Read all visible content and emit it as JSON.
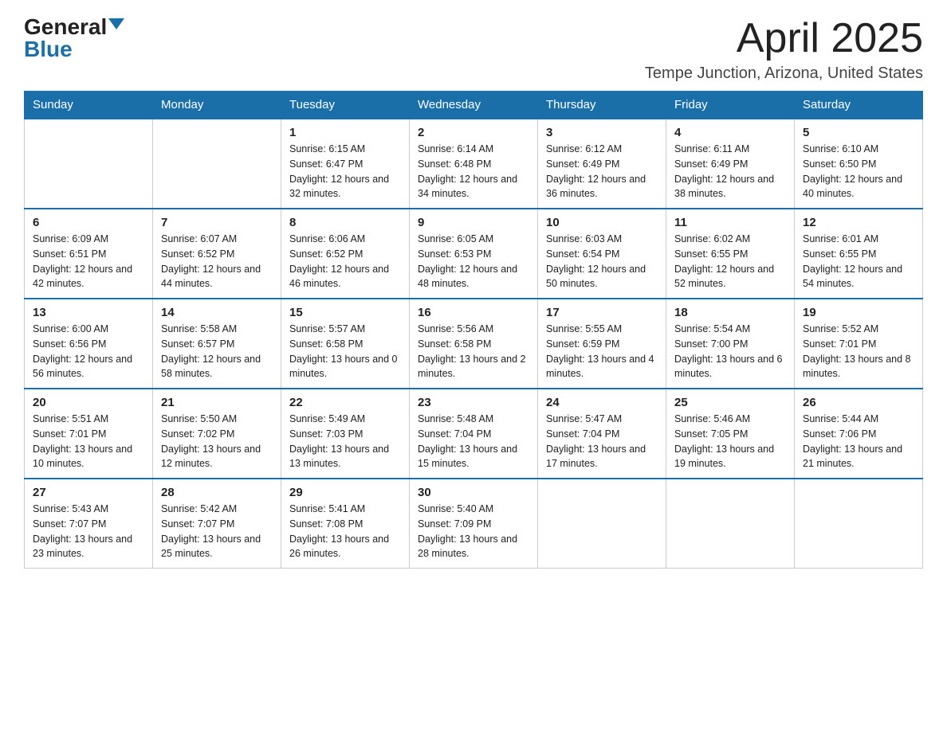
{
  "header": {
    "logo_general": "General",
    "logo_blue": "Blue",
    "month_title": "April 2025",
    "location": "Tempe Junction, Arizona, United States"
  },
  "weekdays": [
    "Sunday",
    "Monday",
    "Tuesday",
    "Wednesday",
    "Thursday",
    "Friday",
    "Saturday"
  ],
  "weeks": [
    [
      {
        "day": "",
        "sunrise": "",
        "sunset": "",
        "daylight": ""
      },
      {
        "day": "",
        "sunrise": "",
        "sunset": "",
        "daylight": ""
      },
      {
        "day": "1",
        "sunrise": "Sunrise: 6:15 AM",
        "sunset": "Sunset: 6:47 PM",
        "daylight": "Daylight: 12 hours and 32 minutes."
      },
      {
        "day": "2",
        "sunrise": "Sunrise: 6:14 AM",
        "sunset": "Sunset: 6:48 PM",
        "daylight": "Daylight: 12 hours and 34 minutes."
      },
      {
        "day": "3",
        "sunrise": "Sunrise: 6:12 AM",
        "sunset": "Sunset: 6:49 PM",
        "daylight": "Daylight: 12 hours and 36 minutes."
      },
      {
        "day": "4",
        "sunrise": "Sunrise: 6:11 AM",
        "sunset": "Sunset: 6:49 PM",
        "daylight": "Daylight: 12 hours and 38 minutes."
      },
      {
        "day": "5",
        "sunrise": "Sunrise: 6:10 AM",
        "sunset": "Sunset: 6:50 PM",
        "daylight": "Daylight: 12 hours and 40 minutes."
      }
    ],
    [
      {
        "day": "6",
        "sunrise": "Sunrise: 6:09 AM",
        "sunset": "Sunset: 6:51 PM",
        "daylight": "Daylight: 12 hours and 42 minutes."
      },
      {
        "day": "7",
        "sunrise": "Sunrise: 6:07 AM",
        "sunset": "Sunset: 6:52 PM",
        "daylight": "Daylight: 12 hours and 44 minutes."
      },
      {
        "day": "8",
        "sunrise": "Sunrise: 6:06 AM",
        "sunset": "Sunset: 6:52 PM",
        "daylight": "Daylight: 12 hours and 46 minutes."
      },
      {
        "day": "9",
        "sunrise": "Sunrise: 6:05 AM",
        "sunset": "Sunset: 6:53 PM",
        "daylight": "Daylight: 12 hours and 48 minutes."
      },
      {
        "day": "10",
        "sunrise": "Sunrise: 6:03 AM",
        "sunset": "Sunset: 6:54 PM",
        "daylight": "Daylight: 12 hours and 50 minutes."
      },
      {
        "day": "11",
        "sunrise": "Sunrise: 6:02 AM",
        "sunset": "Sunset: 6:55 PM",
        "daylight": "Daylight: 12 hours and 52 minutes."
      },
      {
        "day": "12",
        "sunrise": "Sunrise: 6:01 AM",
        "sunset": "Sunset: 6:55 PM",
        "daylight": "Daylight: 12 hours and 54 minutes."
      }
    ],
    [
      {
        "day": "13",
        "sunrise": "Sunrise: 6:00 AM",
        "sunset": "Sunset: 6:56 PM",
        "daylight": "Daylight: 12 hours and 56 minutes."
      },
      {
        "day": "14",
        "sunrise": "Sunrise: 5:58 AM",
        "sunset": "Sunset: 6:57 PM",
        "daylight": "Daylight: 12 hours and 58 minutes."
      },
      {
        "day": "15",
        "sunrise": "Sunrise: 5:57 AM",
        "sunset": "Sunset: 6:58 PM",
        "daylight": "Daylight: 13 hours and 0 minutes."
      },
      {
        "day": "16",
        "sunrise": "Sunrise: 5:56 AM",
        "sunset": "Sunset: 6:58 PM",
        "daylight": "Daylight: 13 hours and 2 minutes."
      },
      {
        "day": "17",
        "sunrise": "Sunrise: 5:55 AM",
        "sunset": "Sunset: 6:59 PM",
        "daylight": "Daylight: 13 hours and 4 minutes."
      },
      {
        "day": "18",
        "sunrise": "Sunrise: 5:54 AM",
        "sunset": "Sunset: 7:00 PM",
        "daylight": "Daylight: 13 hours and 6 minutes."
      },
      {
        "day": "19",
        "sunrise": "Sunrise: 5:52 AM",
        "sunset": "Sunset: 7:01 PM",
        "daylight": "Daylight: 13 hours and 8 minutes."
      }
    ],
    [
      {
        "day": "20",
        "sunrise": "Sunrise: 5:51 AM",
        "sunset": "Sunset: 7:01 PM",
        "daylight": "Daylight: 13 hours and 10 minutes."
      },
      {
        "day": "21",
        "sunrise": "Sunrise: 5:50 AM",
        "sunset": "Sunset: 7:02 PM",
        "daylight": "Daylight: 13 hours and 12 minutes."
      },
      {
        "day": "22",
        "sunrise": "Sunrise: 5:49 AM",
        "sunset": "Sunset: 7:03 PM",
        "daylight": "Daylight: 13 hours and 13 minutes."
      },
      {
        "day": "23",
        "sunrise": "Sunrise: 5:48 AM",
        "sunset": "Sunset: 7:04 PM",
        "daylight": "Daylight: 13 hours and 15 minutes."
      },
      {
        "day": "24",
        "sunrise": "Sunrise: 5:47 AM",
        "sunset": "Sunset: 7:04 PM",
        "daylight": "Daylight: 13 hours and 17 minutes."
      },
      {
        "day": "25",
        "sunrise": "Sunrise: 5:46 AM",
        "sunset": "Sunset: 7:05 PM",
        "daylight": "Daylight: 13 hours and 19 minutes."
      },
      {
        "day": "26",
        "sunrise": "Sunrise: 5:44 AM",
        "sunset": "Sunset: 7:06 PM",
        "daylight": "Daylight: 13 hours and 21 minutes."
      }
    ],
    [
      {
        "day": "27",
        "sunrise": "Sunrise: 5:43 AM",
        "sunset": "Sunset: 7:07 PM",
        "daylight": "Daylight: 13 hours and 23 minutes."
      },
      {
        "day": "28",
        "sunrise": "Sunrise: 5:42 AM",
        "sunset": "Sunset: 7:07 PM",
        "daylight": "Daylight: 13 hours and 25 minutes."
      },
      {
        "day": "29",
        "sunrise": "Sunrise: 5:41 AM",
        "sunset": "Sunset: 7:08 PM",
        "daylight": "Daylight: 13 hours and 26 minutes."
      },
      {
        "day": "30",
        "sunrise": "Sunrise: 5:40 AM",
        "sunset": "Sunset: 7:09 PM",
        "daylight": "Daylight: 13 hours and 28 minutes."
      },
      {
        "day": "",
        "sunrise": "",
        "sunset": "",
        "daylight": ""
      },
      {
        "day": "",
        "sunrise": "",
        "sunset": "",
        "daylight": ""
      },
      {
        "day": "",
        "sunrise": "",
        "sunset": "",
        "daylight": ""
      }
    ]
  ]
}
